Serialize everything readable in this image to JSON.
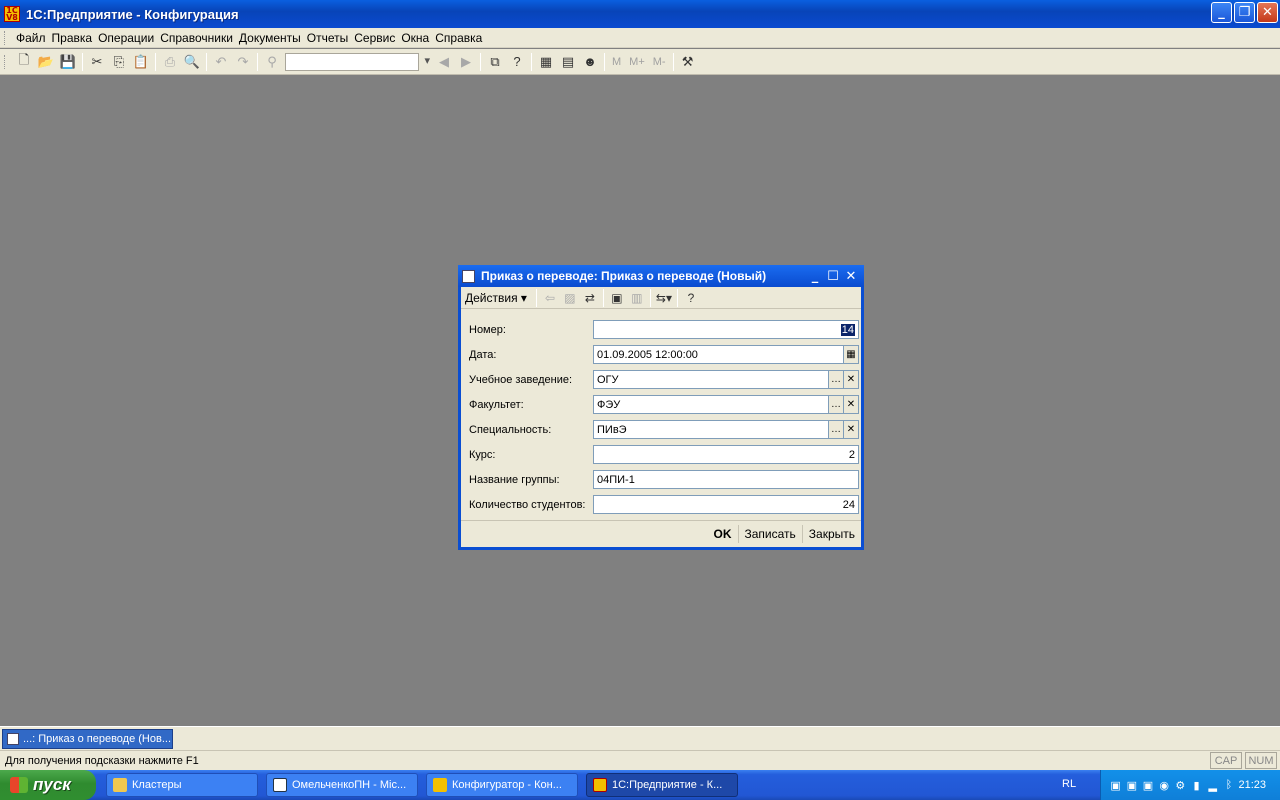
{
  "window": {
    "title": "1С:Предприятие - Конфигурация"
  },
  "menu": [
    "Файл",
    "Правка",
    "Операции",
    "Справочники",
    "Документы",
    "Отчеты",
    "Сервис",
    "Окна",
    "Справка"
  ],
  "toolbar": {
    "m_labels": [
      "M",
      "M+",
      "M-"
    ]
  },
  "document": {
    "title": "Приказ о переводе: Приказ о переводе (Новый)",
    "actions_label": "Действия",
    "fields": {
      "number": {
        "label": "Номер:",
        "value": "14"
      },
      "date": {
        "label": "Дата:",
        "value": "01.09.2005 12:00:00"
      },
      "institution": {
        "label": "Учебное заведение:",
        "value": "ОГУ"
      },
      "faculty": {
        "label": "Факультет:",
        "value": "ФЭУ"
      },
      "specialty": {
        "label": "Специальность:",
        "value": "ПИвЭ"
      },
      "course": {
        "label": "Курс:",
        "value": "2"
      },
      "group": {
        "label": "Название группы:",
        "value": "04ПИ-1"
      },
      "students": {
        "label": "Количество студентов:",
        "value": "24"
      }
    },
    "buttons": {
      "ok": "OK",
      "save": "Записать",
      "close": "Закрыть"
    }
  },
  "window_list": {
    "item": "...: Приказ о переводе (Нов..."
  },
  "status": {
    "hint": "Для получения подсказки нажмите F1",
    "cap": "CAP",
    "num": "NUM"
  },
  "taskbar": {
    "start": "пуск",
    "tasks": [
      "Кластеры",
      "ОмельченкоПН - Mic...",
      "Конфигуратор - Кон...",
      "1С:Предприятие - К..."
    ],
    "lang": "RL",
    "clock": "21:23"
  }
}
